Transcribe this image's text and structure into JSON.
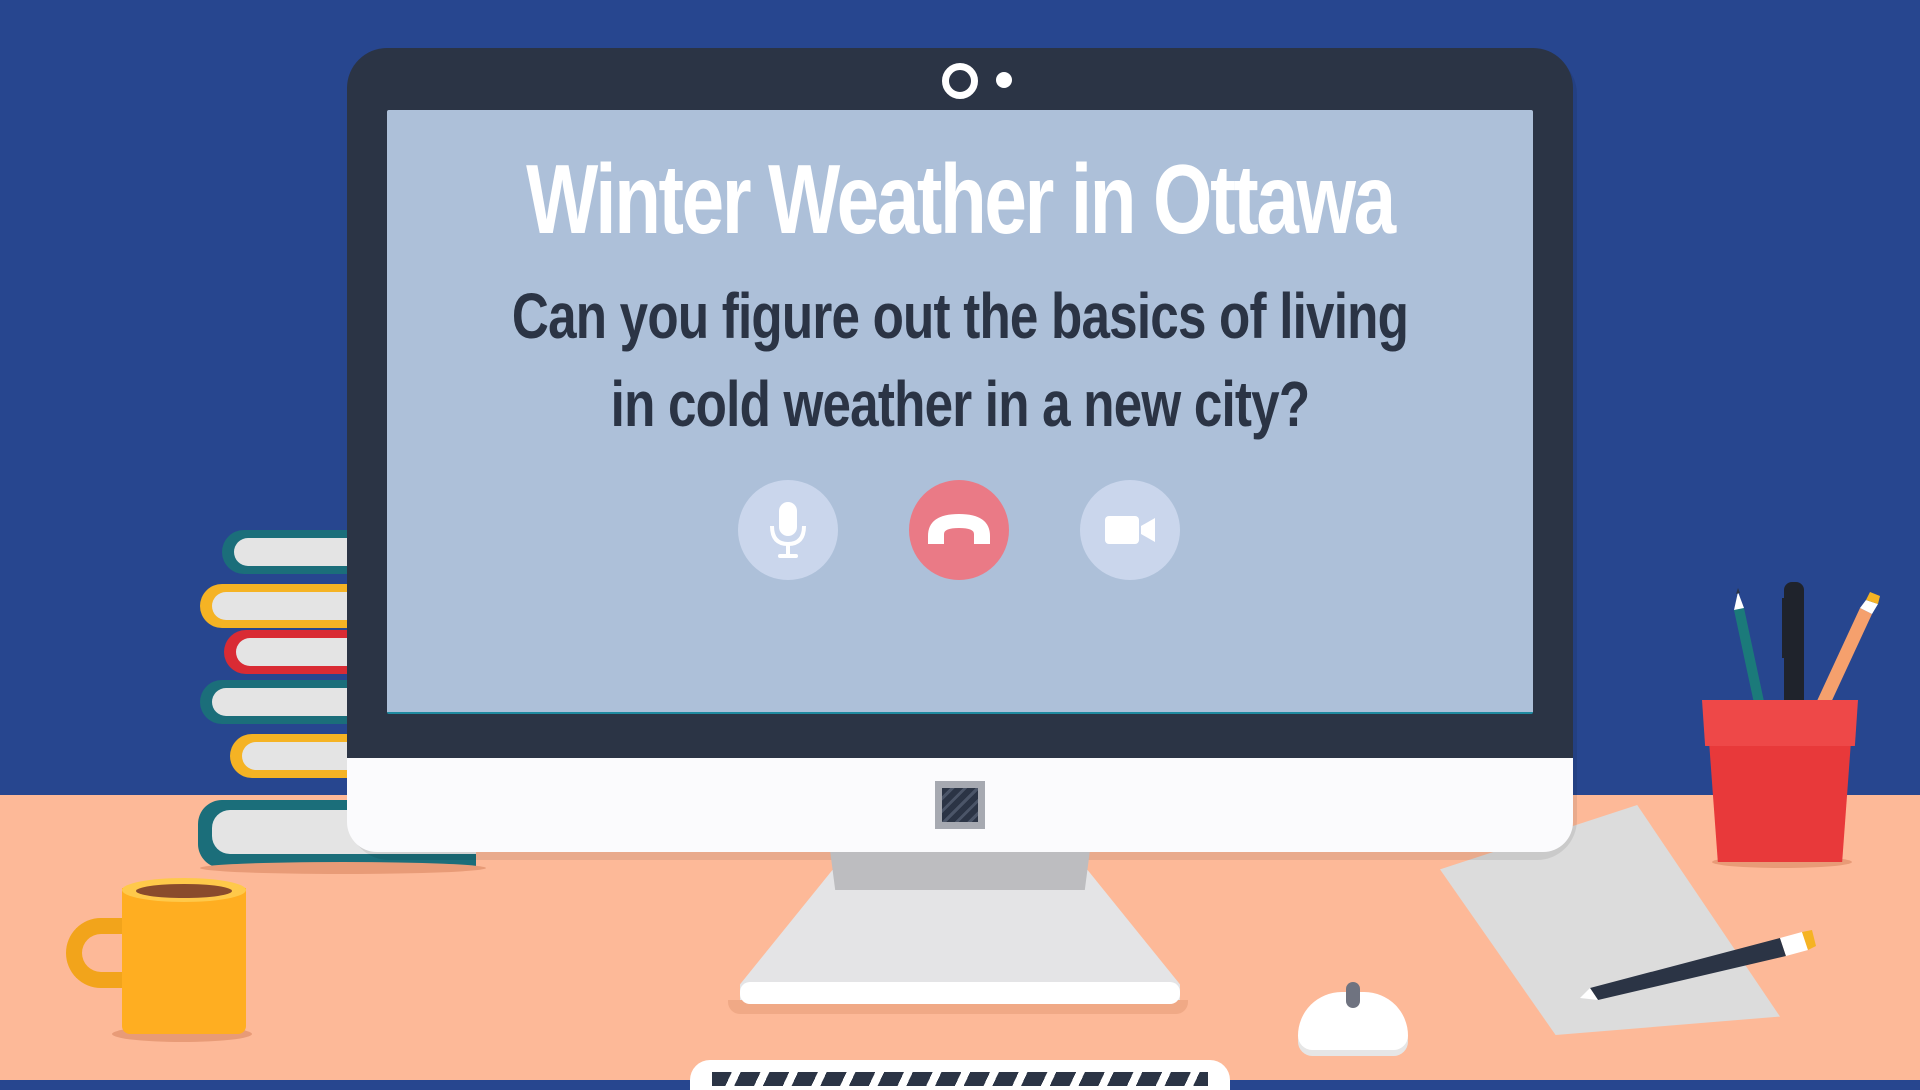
{
  "screen": {
    "title": "Winter Weather in Ottawa",
    "subtitle_line1": "Can you figure out the basics of living",
    "subtitle_line2": "in cold weather in a new city?"
  },
  "call_controls": [
    {
      "id": "mic",
      "icon": "microphone-icon"
    },
    {
      "id": "hang_up",
      "icon": "phone-hang-up-icon"
    },
    {
      "id": "video",
      "icon": "video-camera-icon"
    }
  ],
  "colors": {
    "wall": "#27468f",
    "desk": "#fdb998",
    "screen": "#adc0d9",
    "bezel": "#2b3445",
    "hang_up": "#ea7a86",
    "control_button": "#cad6ec"
  }
}
